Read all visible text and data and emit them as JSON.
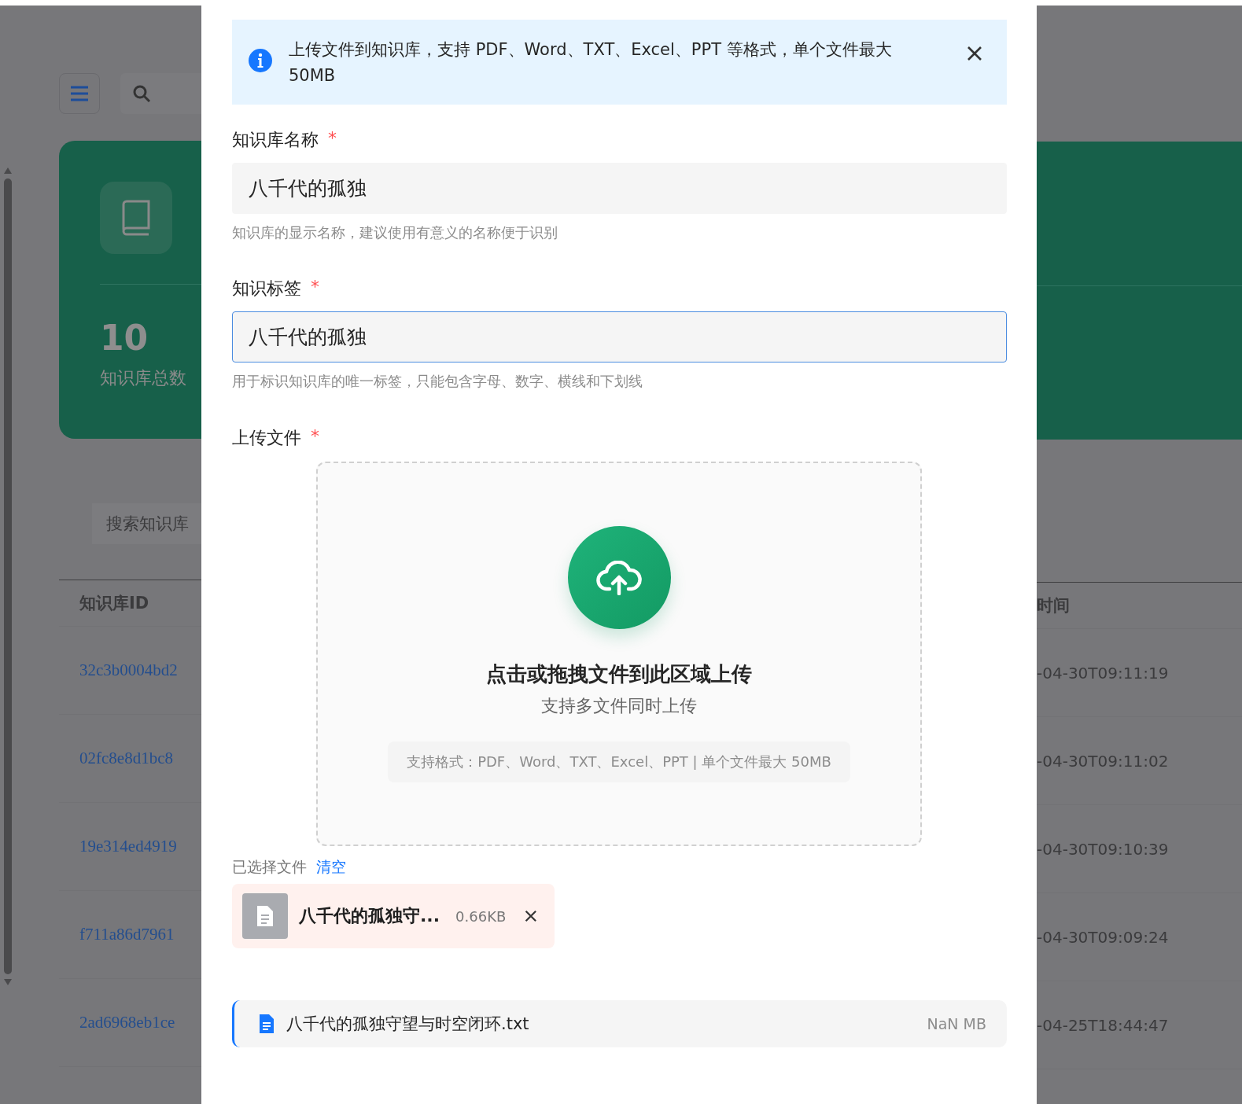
{
  "background_page": {
    "stat_value": "10",
    "stat_label": "知识库总数",
    "search_placeholder": "搜索知识库",
    "table": {
      "columns": [
        "知识库ID",
        "时间"
      ],
      "rows": [
        {
          "id": "32c3b0004bd2",
          "time": "-04-30T09:11:19"
        },
        {
          "id": "02fc8e8d1bc8",
          "time": "-04-30T09:11:02"
        },
        {
          "id": "19e314ed4919",
          "time": "-04-30T09:10:39"
        },
        {
          "id": "f711a86d7961",
          "time": "-04-30T09:09:24"
        },
        {
          "id": "2ad6968eb1ce",
          "time": "-04-25T18:44:47"
        }
      ]
    }
  },
  "dialog": {
    "alert": {
      "text": "上传文件到知识库，支持 PDF、Word、TXT、Excel、PPT 等格式，单个文件最大 50MB"
    },
    "fields": [
      {
        "label": "知识库名称",
        "required_mark": "*",
        "value": "八千代的孤独",
        "hint": "知识库的显示名称，建议使用有意义的名称便于识别",
        "focused": false
      },
      {
        "label": "知识标签",
        "required_mark": "*",
        "value": "八千代的孤独",
        "hint": "用于标识知识库的唯一标签，只能包含字母、数字、横线和下划线",
        "focused": true
      }
    ],
    "upload": {
      "label": "上传文件",
      "required_mark": "*",
      "title": "点击或拖拽文件到此区域上传",
      "subtitle": "支持多文件同时上传",
      "formats": "支持格式：PDF、Word、TXT、Excel、PPT | 单个文件最大 50MB"
    },
    "selected": {
      "label": "已选择文件",
      "clear": "清空",
      "files": [
        {
          "name": "八千代的孤独守...",
          "size": "0.66KB"
        }
      ]
    },
    "file_list": [
      {
        "name": "八千代的孤独守望与时空闭环.txt",
        "size": "NaN MB"
      }
    ]
  }
}
